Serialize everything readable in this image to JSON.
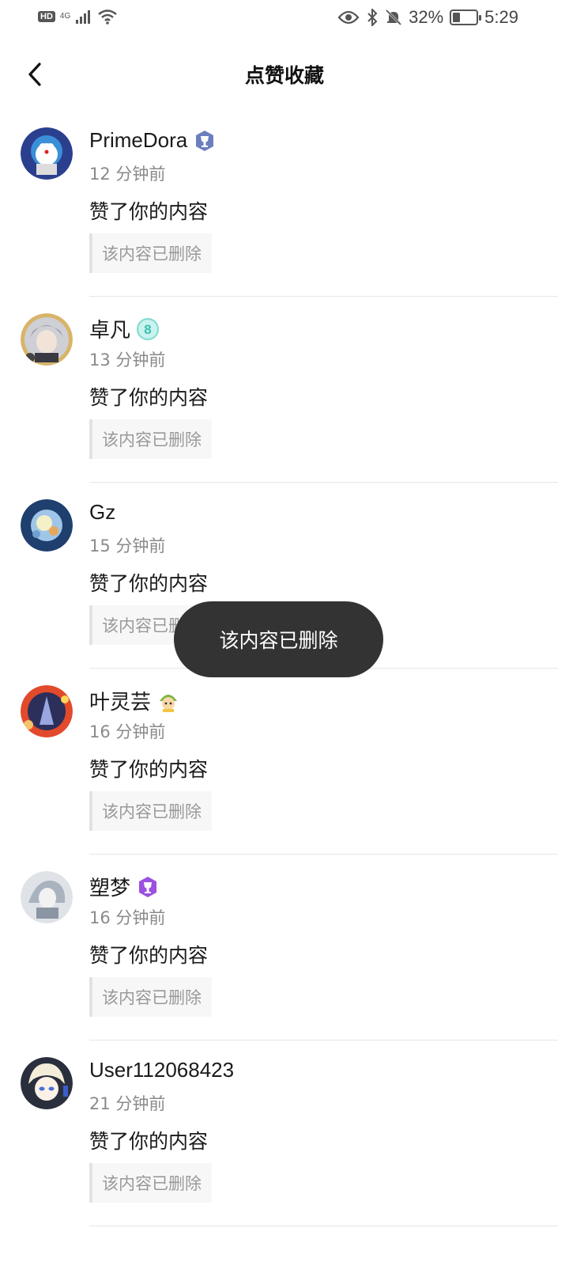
{
  "status_bar": {
    "hd": "HD",
    "network": "4G",
    "battery_pct": "32%",
    "battery_level": 0.32,
    "time": "5:29"
  },
  "header": {
    "title": "点赞收藏"
  },
  "items": [
    {
      "name": "PrimeDora",
      "badge": "trophy-badge-icon",
      "time": "12 分钟前",
      "action": "赞了你的内容",
      "quote": "该内容已删除"
    },
    {
      "name": "卓凡",
      "badge": "level-8-badge-icon",
      "time": "13 分钟前",
      "action": "赞了你的内容",
      "quote": "该内容已删除"
    },
    {
      "name": "Gz",
      "badge": "",
      "time": "15 分钟前",
      "action": "赞了你的内容",
      "quote": "该内容已删除"
    },
    {
      "name": "叶灵芸",
      "badge": "sticker-badge-icon",
      "time": "16 分钟前",
      "action": "赞了你的内容",
      "quote": "该内容已删除"
    },
    {
      "name": "塑梦",
      "badge": "purple-trophy-badge-icon",
      "time": "16 分钟前",
      "action": "赞了你的内容",
      "quote": "该内容已删除"
    },
    {
      "name": "User112068423",
      "badge": "",
      "time": "21 分钟前",
      "action": "赞了你的内容",
      "quote": "该内容已删除"
    }
  ],
  "toast": {
    "message": "该内容已删除"
  },
  "colors": {
    "toast_bg": "#333333",
    "muted_text": "#8a8a8a",
    "quote_bar": "#e2e2e2"
  }
}
